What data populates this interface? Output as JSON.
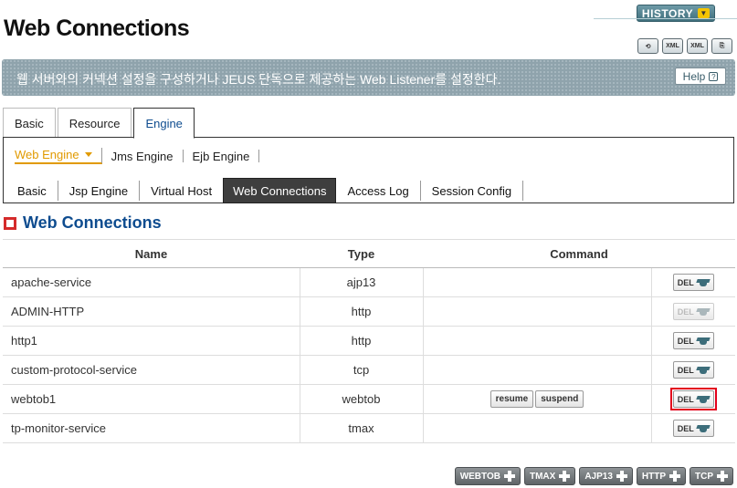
{
  "header": {
    "history_label": "HISTORY",
    "page_title": "Web Connections",
    "tool_icons": [
      {
        "name": "refresh-icon",
        "label": ""
      },
      {
        "name": "xml-import-icon",
        "label": "XML"
      },
      {
        "name": "xml-export-icon",
        "label": "XML"
      },
      {
        "name": "export-icon",
        "label": ""
      }
    ]
  },
  "banner": {
    "text": "웹 서버와의 커넥션 설정을 구성하거나 JEUS 단독으로 제공하는 Web Listener를 설정한다.",
    "help_label": "Help"
  },
  "main_tabs": [
    {
      "label": "Basic",
      "active": false
    },
    {
      "label": "Resource",
      "active": false
    },
    {
      "label": "Engine",
      "active": true
    }
  ],
  "engine_tabs": [
    {
      "label": "Web Engine",
      "active": true
    },
    {
      "label": "Jms Engine",
      "active": false
    },
    {
      "label": "Ejb Engine",
      "active": false
    }
  ],
  "web_tabs": [
    {
      "label": "Basic",
      "active": false
    },
    {
      "label": "Jsp Engine",
      "active": false
    },
    {
      "label": "Virtual Host",
      "active": false
    },
    {
      "label": "Web Connections",
      "active": true
    },
    {
      "label": "Access Log",
      "active": false
    },
    {
      "label": "Session Config",
      "active": false
    }
  ],
  "section": {
    "title": "Web Connections"
  },
  "table": {
    "headers": {
      "name": "Name",
      "type": "Type",
      "command": "Command"
    },
    "del_label": "DEL",
    "rows": [
      {
        "name": "apache-service",
        "type": "ajp13",
        "commands": [],
        "del_enabled": true,
        "highlight": false
      },
      {
        "name": "ADMIN-HTTP",
        "type": "http",
        "commands": [],
        "del_enabled": false,
        "highlight": false
      },
      {
        "name": "http1",
        "type": "http",
        "commands": [],
        "del_enabled": true,
        "highlight": false
      },
      {
        "name": "custom-protocol-service",
        "type": "tcp",
        "commands": [],
        "del_enabled": true,
        "highlight": false
      },
      {
        "name": "webtob1",
        "type": "webtob",
        "commands": [
          "resume",
          "suspend"
        ],
        "del_enabled": true,
        "highlight": true
      },
      {
        "name": "tp-monitor-service",
        "type": "tmax",
        "commands": [],
        "del_enabled": true,
        "highlight": false
      }
    ]
  },
  "add_buttons": [
    "WEBTOB",
    "TMAX",
    "AJP13",
    "HTTP",
    "TCP"
  ],
  "colors": {
    "accent": "#0e4c8f",
    "active_subtab": "#e19a00",
    "highlight": "#e3001b"
  }
}
